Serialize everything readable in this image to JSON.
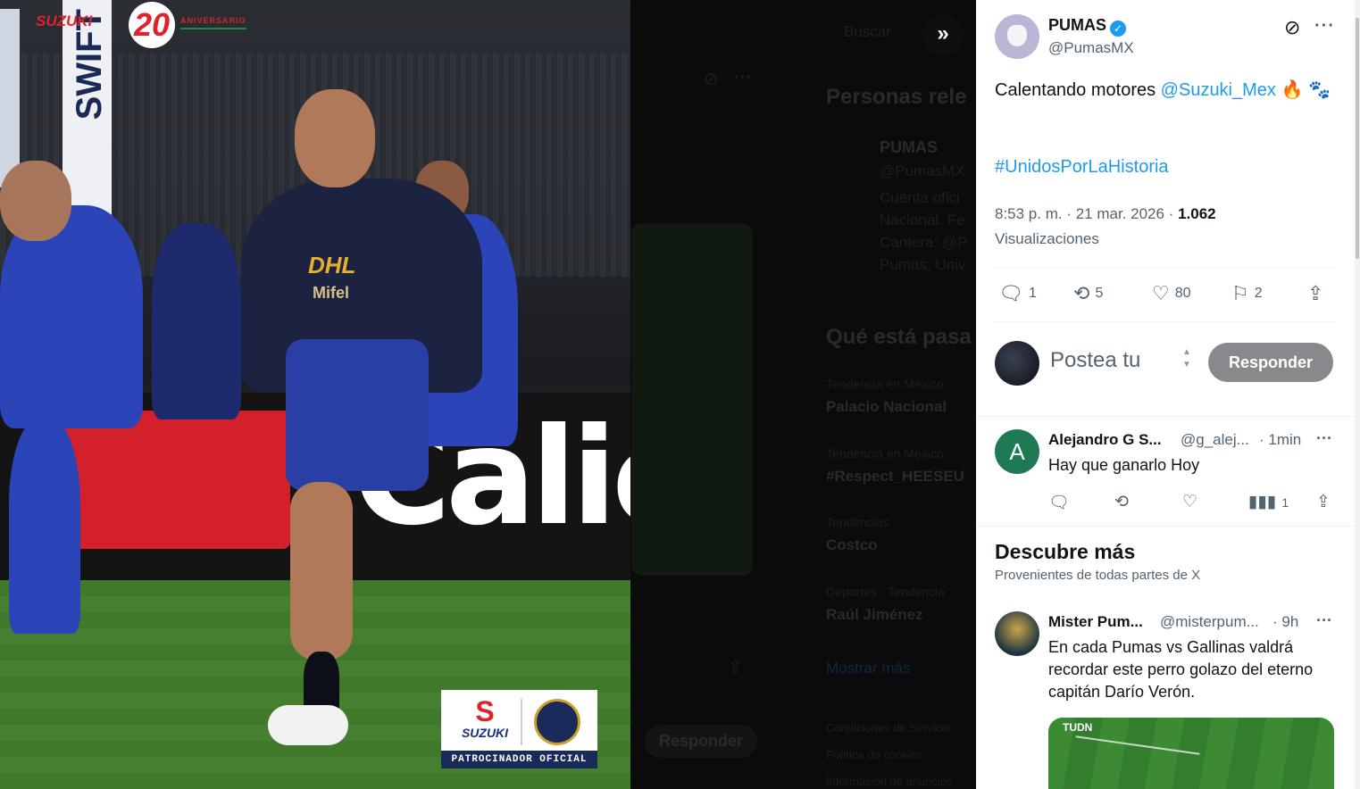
{
  "backdrop": {
    "search_placeholder": "Buscar",
    "section_people": "Personas rele",
    "card_name": "PUMAS",
    "card_handle": "@PumasMX",
    "card_bio_1": "Cuenta ofici",
    "card_bio_2": "Nacional. Fe",
    "card_bio_3": "Cantera: @P",
    "card_bio_4": "Pumas, Univ",
    "section_trends": "Qué está pasa",
    "trends": [
      {
        "context": "Tendencia en México",
        "name": "Palacio Nacional"
      },
      {
        "context": "Tendencia en México",
        "name": "#Respect_HEESEU"
      },
      {
        "context": "Tendencias",
        "name": "Costco"
      },
      {
        "context": "Deportes · Tendencia",
        "name": "Raúl Jiménez"
      }
    ],
    "show_more": "Mostrar más",
    "footer_1": "Condiciones de Servicio",
    "footer_2": "Política de cookies",
    "footer_3": "Información de anuncios",
    "bg_reply": "Responder"
  },
  "photo": {
    "brand": "SUZUKI",
    "brand_number": "20",
    "brand_tag": "ANIVERSARIO",
    "banner_text": "SWIFT",
    "jersey_sponsor": "DHL",
    "jersey_sponsor_2": "Mifel",
    "board_text": "Calie",
    "sponsor_logo": "S",
    "sponsor_name": "SUZUKI",
    "sponsor_footer": "PATROCINADOR OFICIAL"
  },
  "post": {
    "author_name": "PUMAS",
    "author_handle": "@PumasMX",
    "text_prefix": "Calentando motores ",
    "mention": "@Suzuki_Mex",
    "emoji_line": "🔥 🐾",
    "hashtag": "#UnidosPorLaHistoria",
    "time": "8:53 p. m.",
    "date": "21 mar. 2026",
    "views_count": "1.062",
    "views_label": "Visualizaciones",
    "replies": "1",
    "reposts": "5",
    "likes": "80",
    "bookmarks": "2"
  },
  "reply_box": {
    "placeholder": "Postea tu",
    "button": "Responder"
  },
  "comments": [
    {
      "avatar_letter": "A",
      "name": "Alejandro G S...",
      "handle": "@g_alej...",
      "time": "· 1min",
      "text": "Hay que ganarlo Hoy",
      "views": "1"
    }
  ],
  "discover": {
    "title": "Descubre más",
    "subtitle": "Provenientes de todas partes de X",
    "post": {
      "name": "Mister Pum...",
      "handle": "@misterpum...",
      "time": "· 9h",
      "text": "En cada Pumas vs Gallinas valdrá recordar este perro golazo del eterno capitán Darío Verón.",
      "video_logo": "TUDN"
    }
  },
  "colors": {
    "accent": "#1d9bf0",
    "text": "#0f1419",
    "muted": "#536471",
    "reply_btn": "#87898c"
  },
  "icons": {
    "expand": "double-chevron-right-icon",
    "grok": "grok-icon",
    "more": "more-icon",
    "reply": "reply-icon",
    "repost": "repost-icon",
    "like": "heart-icon",
    "bookmark": "bookmark-icon",
    "share": "share-icon",
    "views": "views-icon",
    "verified": "verified-icon"
  }
}
